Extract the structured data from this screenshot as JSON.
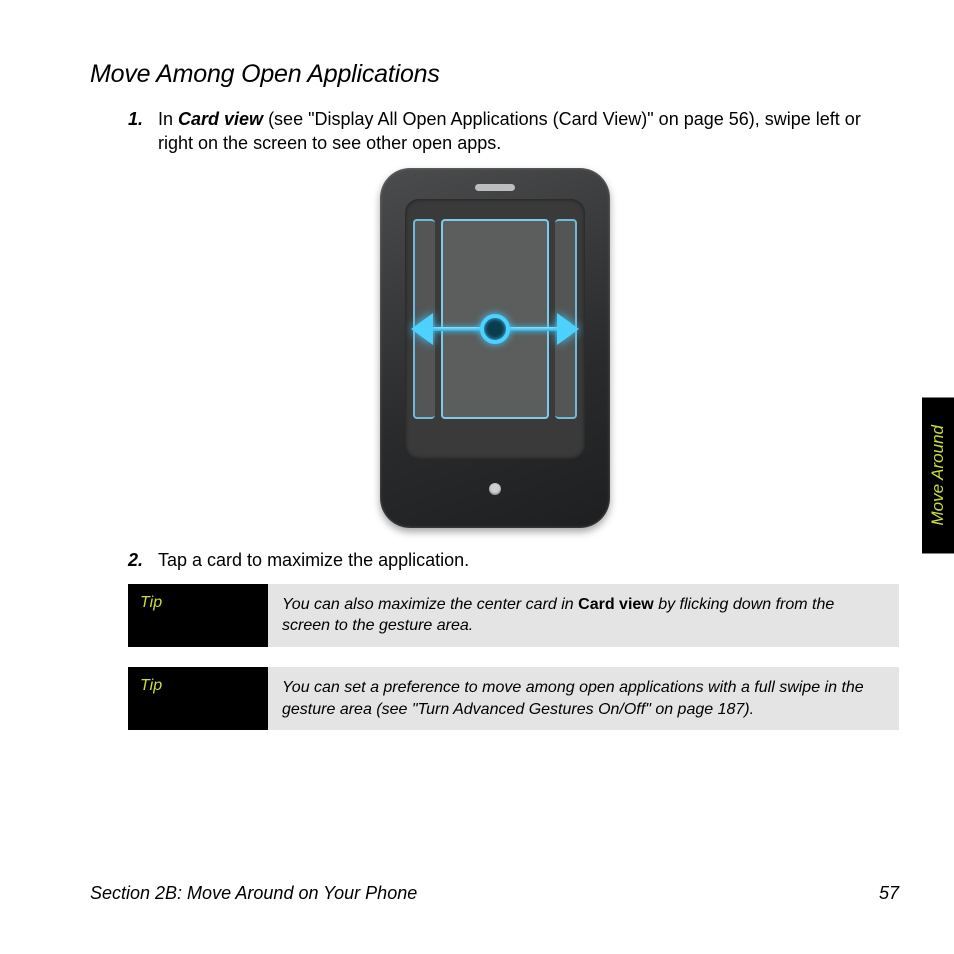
{
  "heading": "Move Among Open Applications",
  "steps": [
    {
      "num": "1.",
      "pre": "In ",
      "em": "Card view",
      "post": " (see \"Display All Open Applications (Card View)\" on page 56), swipe left or right on the screen to see other open apps."
    },
    {
      "num": "2.",
      "post": "Tap a card to maximize the application."
    }
  ],
  "tips": [
    {
      "label": "Tip",
      "pre": "You can also maximize the center card in ",
      "bold": "Card view",
      "post": " by flicking down from the screen to the gesture area."
    },
    {
      "label": "Tip",
      "post": "You can set a preference to move among open applications with a full swipe in the gesture area (see \"Turn Advanced Gestures On/Off\" on page 187)."
    }
  ],
  "side_tab": "Move Around",
  "footer": {
    "section": "Section 2B: Move Around on Your Phone",
    "page": "57"
  }
}
